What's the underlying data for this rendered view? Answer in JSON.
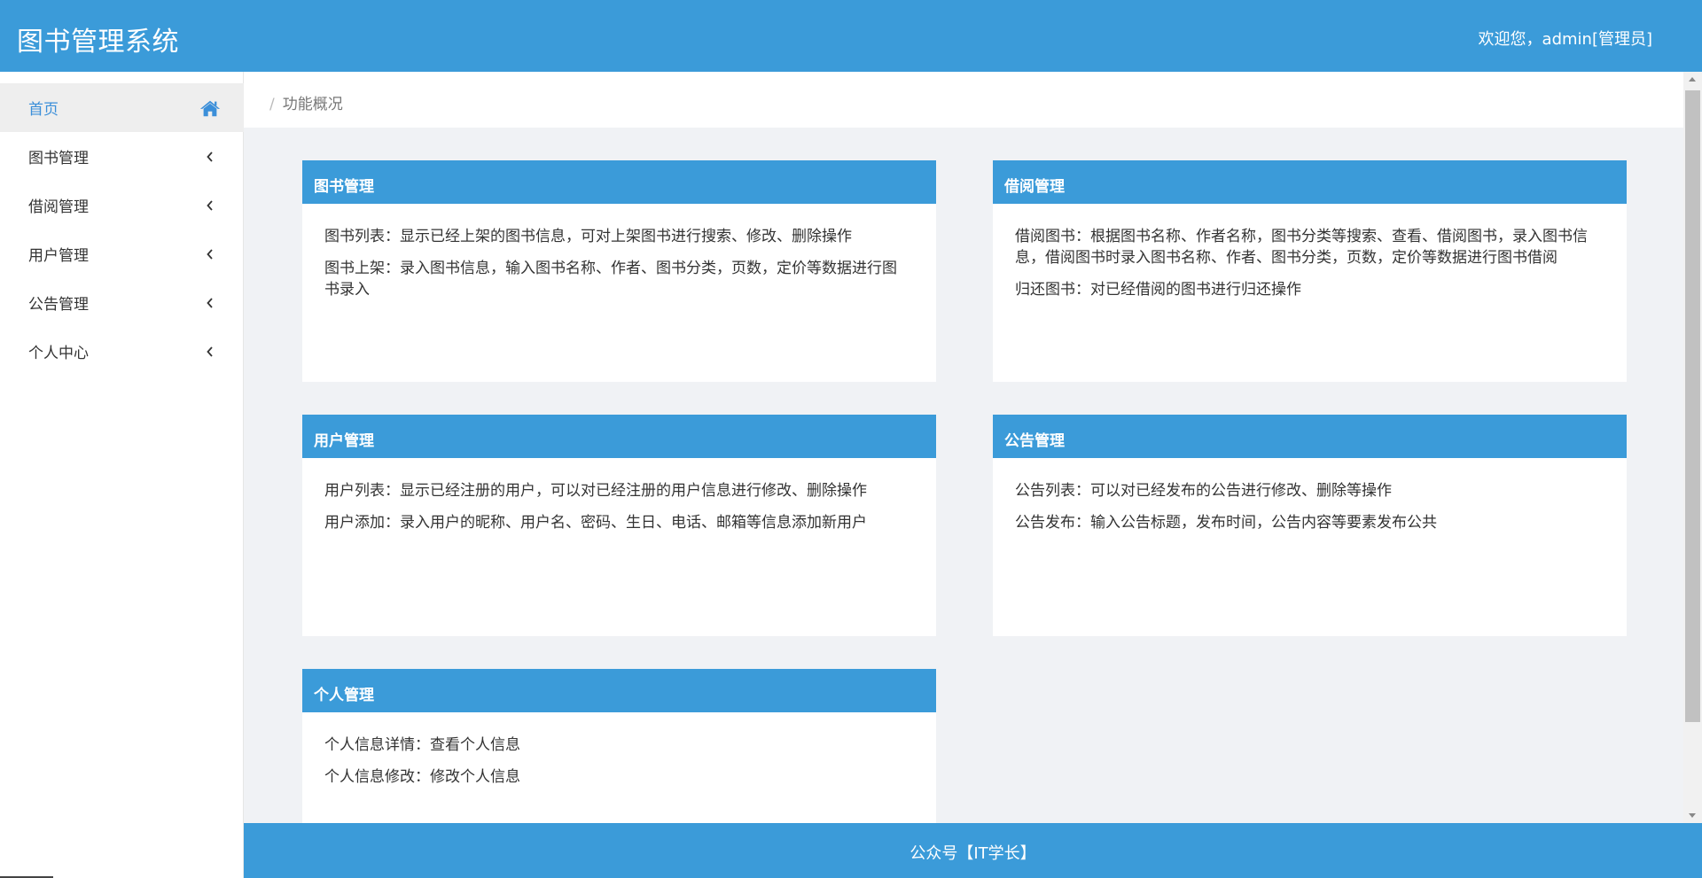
{
  "header": {
    "title": "图书管理系统",
    "welcome": "欢迎您，admin[管理员]"
  },
  "sidebar": {
    "items": [
      {
        "label": "首页",
        "icon": "home-icon",
        "active": true
      },
      {
        "label": "图书管理",
        "icon": "chevron-left-icon"
      },
      {
        "label": "借阅管理",
        "icon": "chevron-left-icon"
      },
      {
        "label": "用户管理",
        "icon": "chevron-left-icon"
      },
      {
        "label": "公告管理",
        "icon": "chevron-left-icon"
      },
      {
        "label": "个人中心",
        "icon": "chevron-left-icon"
      }
    ]
  },
  "breadcrumb": {
    "separator": "/",
    "current": "功能概况"
  },
  "cards": [
    {
      "title": "图书管理",
      "lines": [
        "图书列表：显示已经上架的图书信息，可对上架图书进行搜索、修改、删除操作",
        "图书上架：录入图书信息，输入图书名称、作者、图书分类，页数，定价等数据进行图书录入"
      ]
    },
    {
      "title": "借阅管理",
      "lines": [
        "借阅图书：根据图书名称、作者名称，图书分类等搜索、查看、借阅图书，录入图书信息，借阅图书时录入图书名称、作者、图书分类，页数，定价等数据进行图书借阅",
        "归还图书：对已经借阅的图书进行归还操作"
      ]
    },
    {
      "title": "用户管理",
      "lines": [
        "用户列表：显示已经注册的用户，可以对已经注册的用户信息进行修改、删除操作",
        "用户添加：录入用户的昵称、用户名、密码、生日、电话、邮箱等信息添加新用户"
      ]
    },
    {
      "title": "公告管理",
      "lines": [
        "公告列表：可以对已经发布的公告进行修改、删除等操作",
        "公告发布：输入公告标题，发布时间，公告内容等要素发布公共"
      ]
    },
    {
      "title": "个人管理",
      "lines": [
        "个人信息详情：查看个人信息",
        "个人信息修改：修改个人信息"
      ]
    }
  ],
  "footer": {
    "text": "公众号【IT学长】"
  },
  "colors": {
    "primary": "#3b9bd9",
    "active_text": "#3b8fd9",
    "background": "#f0f2f5"
  }
}
